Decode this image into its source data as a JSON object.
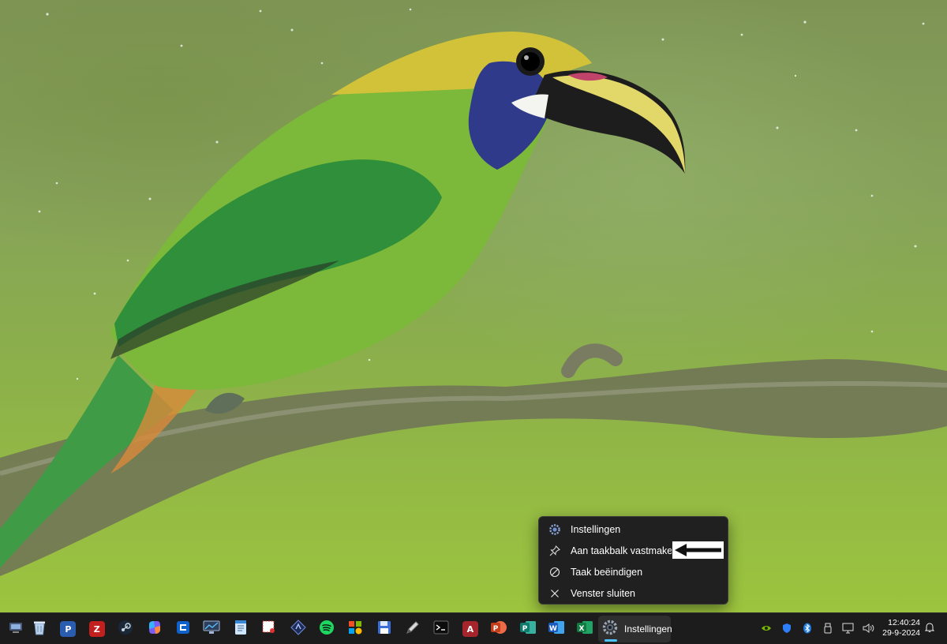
{
  "context_menu": {
    "items": [
      {
        "label": "Instellingen",
        "icon": "settings-gear-icon"
      },
      {
        "label": "Aan taakbalk vastmaken",
        "icon": "pin-icon"
      },
      {
        "label": "Taak beëindigen",
        "icon": "end-task-icon"
      },
      {
        "label": "Venster sluiten",
        "icon": "close-icon"
      }
    ]
  },
  "taskbar": {
    "active_app_label": "Instellingen",
    "pinned_apps": [
      "file-manager-icon",
      "recycle-icon",
      "publisher-icon",
      "filezilla-icon",
      "steam-icon",
      "copilot-icon",
      "app-blue-icon",
      "display-app-icon",
      "notepad-icon",
      "snipping-icon",
      "editor-icon",
      "spotify-icon",
      "store-icon",
      "save-icon",
      "pen-icon",
      "terminal-icon",
      "access-icon",
      "powerpoint-icon",
      "project-icon",
      "word-icon",
      "excel-icon"
    ],
    "tray_icons": [
      "nvidia-icon",
      "defender-icon",
      "bluetooth-icon",
      "usb-icon",
      "network-icon",
      "volume-icon"
    ],
    "clock_time": "12:40:24",
    "clock_date": "29-9-2024"
  },
  "colors": {
    "taskbar_bg": "#1c1c1c",
    "menu_bg": "#202020",
    "accent": "#4cc2ff"
  }
}
